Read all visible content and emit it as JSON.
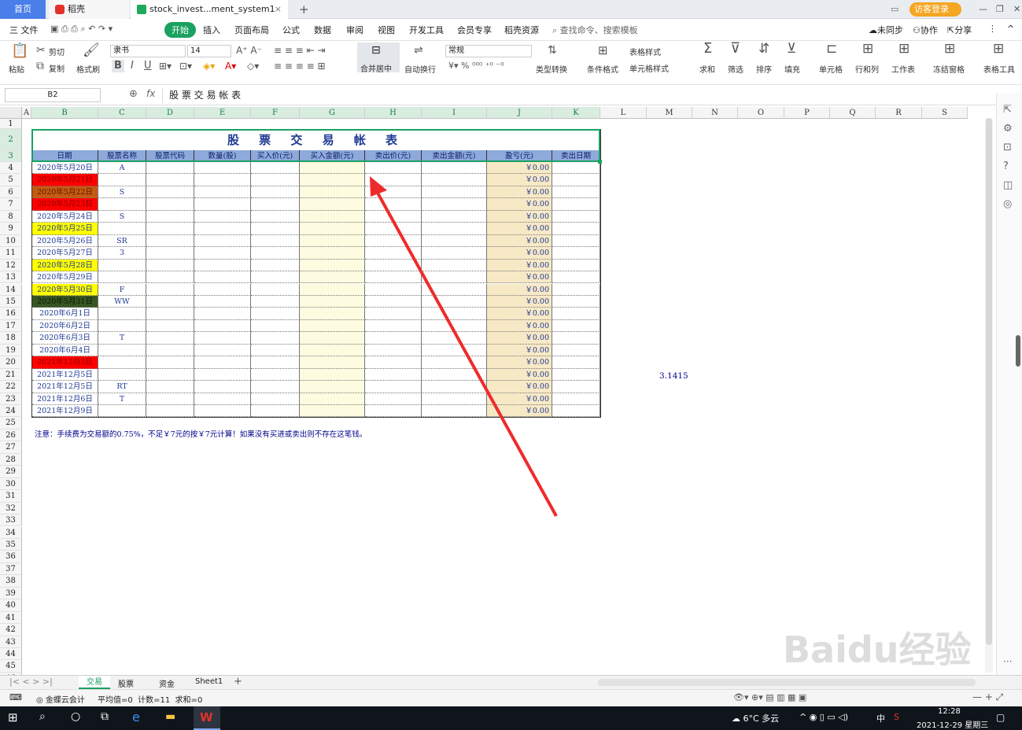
{
  "tabs": {
    "home": "首页",
    "daoke": "稻壳",
    "file": "stock_invest...ment_system1",
    "new": "+",
    "login": "访客登录"
  },
  "menu": [
    "三 文件",
    "开始",
    "插入",
    "页面布局",
    "公式",
    "数据",
    "审阅",
    "视图",
    "开发工具",
    "会员专享",
    "稻壳资源"
  ],
  "menu_right": {
    "search": "查找命令、搜索模板",
    "sync": "未同步",
    "collab": "协作",
    "share": "分享"
  },
  "ribbon": {
    "paste": "粘贴",
    "cut": "剪切",
    "copy": "复制",
    "format_painter": "格式刷",
    "font": "隶书",
    "size": "14",
    "merge": "合并居中",
    "wrap": "自动换行",
    "numfmt": "常规",
    "type_convert": "类型转换",
    "cond_format": "条件格式",
    "table_style": "表格样式",
    "cell_style": "单元格样式",
    "sum": "求和",
    "filter": "筛选",
    "sort": "排序",
    "fill": "填充",
    "cell": "单元格",
    "rowcol": "行和列",
    "sheet": "工作表",
    "freeze": "冻结窗格",
    "tools": "表格工具"
  },
  "formula": {
    "namebox": "B2",
    "fx": "fx",
    "content": "股 票 交 易 帐 表"
  },
  "columns": [
    "A",
    "B",
    "C",
    "D",
    "E",
    "F",
    "G",
    "H",
    "I",
    "J",
    "K",
    "L",
    "M",
    "N",
    "O",
    "P",
    "Q",
    "R",
    "S"
  ],
  "rows": [
    "1",
    "2",
    "3",
    "4",
    "5",
    "6",
    "7",
    "8",
    "9",
    "10",
    "11",
    "12",
    "13",
    "14",
    "15",
    "16",
    "17",
    "18",
    "19",
    "20",
    "21",
    "22",
    "23",
    "24",
    "25",
    "26",
    "27",
    "28",
    "29",
    "30",
    "31",
    "32",
    "33",
    "34",
    "35",
    "36",
    "37",
    "38",
    "39",
    "40",
    "41",
    "42",
    "43",
    "44",
    "45",
    "46"
  ],
  "sheet": {
    "title": "股 票 交 易 帐 表",
    "headers": [
      "日期",
      "股票名称",
      "股票代码",
      "数量(股)",
      "买入价(元)",
      "买入金额(元)",
      "卖出价(元)",
      "卖出金额(元)",
      "盈亏(元)",
      "卖出日期"
    ],
    "dates": [
      "2020年5月20日",
      "2020年5月21日",
      "2020年5月22日",
      "2020年5月23日",
      "2020年5月24日",
      "2020年5月25日",
      "2020年5月26日",
      "2020年5月27日",
      "2020年5月28日",
      "2020年5月29日",
      "2020年5月30日",
      "2020年5月31日",
      "2020年6月1日",
      "2020年6月2日",
      "2020年6月3日",
      "2020年6月4日",
      "2021年12月5日",
      "2021年12月5日",
      "2021年12月5日",
      "2021年12月6日",
      "2021年12月9日"
    ],
    "date_colors": [
      "#ffffff",
      "#ff0000",
      "#c55a11",
      "#ff0000",
      "#ffffff",
      "#ffff00",
      "#ffffff",
      "#ffffff",
      "#ffff00",
      "#ffffff",
      "#ffff00",
      "#375623",
      "#ffffff",
      "#ffffff",
      "#ffffff",
      "#ffffff",
      "#ff0000",
      "#ffffff",
      "#ffffff",
      "#ffffff",
      "#ffffff"
    ],
    "names": [
      "A",
      "",
      "S",
      "",
      "S",
      "",
      "SR",
      "3",
      "",
      "",
      "F",
      "WW",
      "",
      "",
      "T",
      "",
      "",
      "",
      "RT",
      "T",
      ""
    ],
    "pnl": "￥0.00",
    "note": "注意：手续费为交易额的0.75%，不足￥7元的按￥7元计算！如果没有买进或卖出则不存在这笔钱。",
    "m21": "3.1415"
  },
  "sheet_tabs": [
    "交易",
    "股票",
    "资金",
    "Sheet1"
  ],
  "status": {
    "cloud": "金蝶云会计",
    "stats": "平均值=0  计数=11  求和=0"
  },
  "taskbar": {
    "weather": "6°C 多云",
    "time": "12:28",
    "date": "2021-12-29 星期三",
    "ime": "中"
  },
  "watermark": "Baidu经验"
}
